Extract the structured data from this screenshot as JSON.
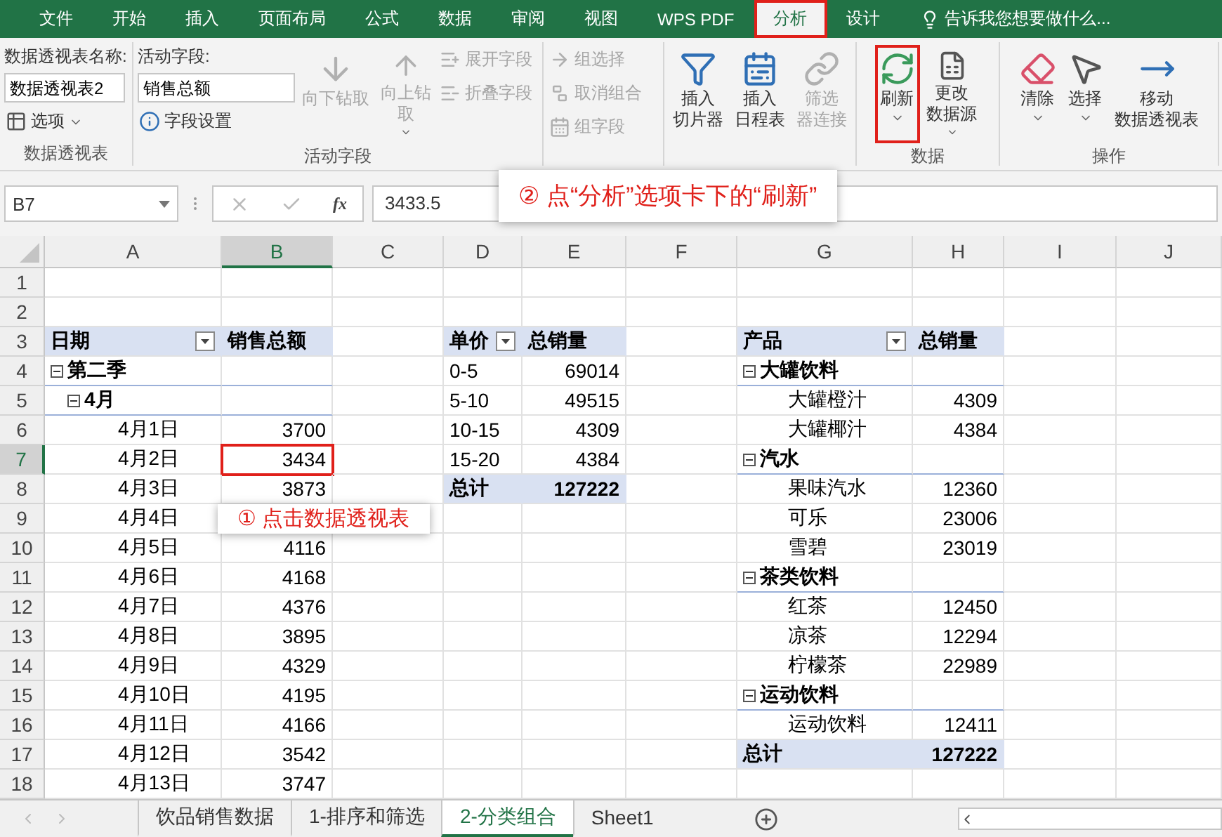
{
  "menu_tabs": [
    {
      "label": "文件",
      "selected": false,
      "annotated": false
    },
    {
      "label": "开始",
      "selected": false,
      "annotated": false
    },
    {
      "label": "插入",
      "selected": false,
      "annotated": false
    },
    {
      "label": "页面布局",
      "selected": false,
      "annotated": false
    },
    {
      "label": "公式",
      "selected": false,
      "annotated": false
    },
    {
      "label": "数据",
      "selected": false,
      "annotated": false
    },
    {
      "label": "审阅",
      "selected": false,
      "annotated": false
    },
    {
      "label": "视图",
      "selected": false,
      "annotated": false
    },
    {
      "label": "WPS PDF",
      "selected": false,
      "annotated": false
    },
    {
      "label": "分析",
      "selected": true,
      "annotated": true
    },
    {
      "label": "设计",
      "selected": false,
      "annotated": false
    }
  ],
  "tell_me": {
    "placeholder": "告诉我您想要做什么..."
  },
  "ribbon_groups": [
    {
      "label": "数据透视表",
      "columns": [
        [
          {
            "kind": "caption",
            "label": "数据透视表名称:"
          },
          {
            "kind": "field",
            "value": "数据透视表2"
          },
          {
            "kind": "small",
            "label": "选项",
            "disabled": false,
            "dropdown": true
          }
        ]
      ]
    },
    {
      "label": "活动字段",
      "columns": [
        [
          {
            "kind": "caption",
            "label": "活动字段:"
          },
          {
            "kind": "field",
            "value": "销售总额"
          },
          {
            "kind": "small",
            "label": "字段设置",
            "disabled": false,
            "dropdown": false
          }
        ],
        [
          {
            "kind": "large",
            "label": "向下钻取",
            "disabled": true,
            "dropdown": false,
            "annotated": false
          }
        ],
        [
          {
            "kind": "large",
            "label": "向上钻取",
            "disabled": true,
            "dropdown": true,
            "annotated": false
          }
        ],
        [
          {
            "kind": "small",
            "label": "展开字段",
            "disabled": true,
            "dropdown": false
          },
          {
            "kind": "small",
            "label": "折叠字段",
            "disabled": true,
            "dropdown": false
          }
        ]
      ]
    },
    {
      "columns": [
        [
          {
            "kind": "small",
            "label": "组选择",
            "disabled": true,
            "dropdown": false
          },
          {
            "kind": "small",
            "label": "取消组合",
            "disabled": true,
            "dropdown": false
          },
          {
            "kind": "small",
            "label": "组字段",
            "disabled": true,
            "dropdown": false
          }
        ]
      ]
    },
    {
      "columns": [
        [
          {
            "kind": "large",
            "label": "插入切片器",
            "disabled": false,
            "dropdown": false,
            "annotated": false
          }
        ],
        [
          {
            "kind": "large",
            "label": "插入日程表",
            "disabled": false,
            "dropdown": false,
            "annotated": false
          }
        ],
        [
          {
            "kind": "large",
            "label": "筛选器连接",
            "disabled": true,
            "dropdown": false,
            "annotated": false
          }
        ]
      ]
    },
    {
      "label": "数据",
      "columns": [
        [
          {
            "kind": "large",
            "label": "刷新",
            "disabled": false,
            "dropdown": true,
            "annotated": true
          }
        ],
        [
          {
            "kind": "large",
            "label": "更改数据源",
            "disabled": false,
            "dropdown": true,
            "annotated": false
          }
        ]
      ]
    },
    {
      "label": "操作",
      "columns": [
        [
          {
            "kind": "large",
            "label": "清除",
            "disabled": false,
            "dropdown": true,
            "annotated": false
          }
        ],
        [
          {
            "kind": "large",
            "label": "选择",
            "disabled": false,
            "dropdown": true,
            "annotated": false
          }
        ],
        [
          {
            "kind": "large",
            "label": "移动数据透视表",
            "disabled": false,
            "dropdown": false,
            "annotated": false
          }
        ]
      ]
    }
  ],
  "formula_bar": {
    "name_box": "B7",
    "function_label": "fx",
    "value": "3433.5"
  },
  "columns": [
    {
      "label": "A",
      "selected": false
    },
    {
      "label": "B",
      "selected": true
    },
    {
      "label": "C",
      "selected": false
    },
    {
      "label": "D",
      "selected": false
    },
    {
      "label": "E",
      "selected": false
    },
    {
      "label": "F",
      "selected": false
    },
    {
      "label": "G",
      "selected": false
    },
    {
      "label": "H",
      "selected": false
    },
    {
      "label": "I",
      "selected": false
    },
    {
      "label": "J",
      "selected": false
    }
  ],
  "rows": [
    {
      "label": "1",
      "selected": false
    },
    {
      "label": "2",
      "selected": false
    },
    {
      "label": "3",
      "selected": false
    },
    {
      "label": "4",
      "selected": false
    },
    {
      "label": "5",
      "selected": false
    },
    {
      "label": "6",
      "selected": false
    },
    {
      "label": "7",
      "selected": true
    },
    {
      "label": "8",
      "selected": false
    },
    {
      "label": "9",
      "selected": false
    },
    {
      "label": "10",
      "selected": false
    },
    {
      "label": "11",
      "selected": false
    },
    {
      "label": "12",
      "selected": false
    },
    {
      "label": "13",
      "selected": false
    },
    {
      "label": "14",
      "selected": false
    },
    {
      "label": "15",
      "selected": false
    },
    {
      "label": "16",
      "selected": false
    },
    {
      "label": "17",
      "selected": false
    },
    {
      "label": "18",
      "selected": false
    }
  ],
  "pivot_tables": [
    {
      "headers": [
        {
          "label": "日期",
          "filter": true
        },
        {
          "label": "销售总额",
          "filter": false
        }
      ],
      "rows": [
        {
          "label": "第二季",
          "expanded": true,
          "children": [
            {
              "label": "4月",
              "expanded": true,
              "children": [
                {
                  "label": "4月1日",
                  "value": "3700"
                },
                {
                  "label": "4月2日",
                  "value": "3434"
                },
                {
                  "label": "4月3日",
                  "value": "3873"
                },
                {
                  "label": "4月4日"
                },
                {
                  "label": "4月5日",
                  "value": "4116"
                },
                {
                  "label": "4月6日",
                  "value": "4168"
                },
                {
                  "label": "4月7日",
                  "value": "4376"
                },
                {
                  "label": "4月8日",
                  "value": "3895"
                },
                {
                  "label": "4月9日",
                  "value": "4329"
                },
                {
                  "label": "4月10日",
                  "value": "4195"
                },
                {
                  "label": "4月11日",
                  "value": "4166"
                },
                {
                  "label": "4月12日",
                  "value": "3542"
                },
                {
                  "label": "4月13日",
                  "value": "3747"
                }
              ]
            }
          ]
        }
      ]
    },
    {
      "headers": [
        {
          "label": "单价",
          "filter": true
        },
        {
          "label": "总销量",
          "filter": false
        }
      ],
      "rows": [
        {
          "label": "0-5",
          "value": "69014"
        },
        {
          "label": "5-10",
          "value": "49515"
        },
        {
          "label": "10-15",
          "value": "4309"
        },
        {
          "label": "15-20",
          "value": "4384"
        }
      ],
      "total": {
        "label": "总计",
        "value": "127222"
      }
    },
    {
      "headers": [
        {
          "label": "产品",
          "filter": true
        },
        {
          "label": "总销量",
          "filter": false
        }
      ],
      "rows": [
        {
          "label": "大罐饮料",
          "expanded": true,
          "children": [
            {
              "label": "大罐橙汁",
              "value": "4309"
            },
            {
              "label": "大罐椰汁",
              "value": "4384"
            }
          ]
        },
        {
          "label": "汽水",
          "expanded": true,
          "children": [
            {
              "label": "果味汽水",
              "value": "12360"
            },
            {
              "label": "可乐",
              "value": "23006"
            },
            {
              "label": "雪碧",
              "value": "23019"
            }
          ]
        },
        {
          "label": "茶类饮料",
          "expanded": true,
          "children": [
            {
              "label": "红茶",
              "value": "12450"
            },
            {
              "label": "凉茶",
              "value": "12294"
            },
            {
              "label": "柠檬茶",
              "value": "22989"
            }
          ]
        },
        {
          "label": "运动饮料",
          "expanded": true,
          "children": [
            {
              "label": "运动饮料",
              "value": "12411"
            }
          ]
        }
      ],
      "total": {
        "label": "总计",
        "value": "127222"
      }
    }
  ],
  "callouts": [
    {
      "text": "② 点“分析”选项卡下的“刷新”"
    },
    {
      "text": "① 点击数据透视表"
    }
  ],
  "sheet_tabs": [
    {
      "label": "饮品销售数据",
      "selected": false
    },
    {
      "label": "1-排序和筛选",
      "selected": false
    },
    {
      "label": "2-分类组合",
      "selected": true
    },
    {
      "label": "Sheet1",
      "selected": false
    }
  ]
}
